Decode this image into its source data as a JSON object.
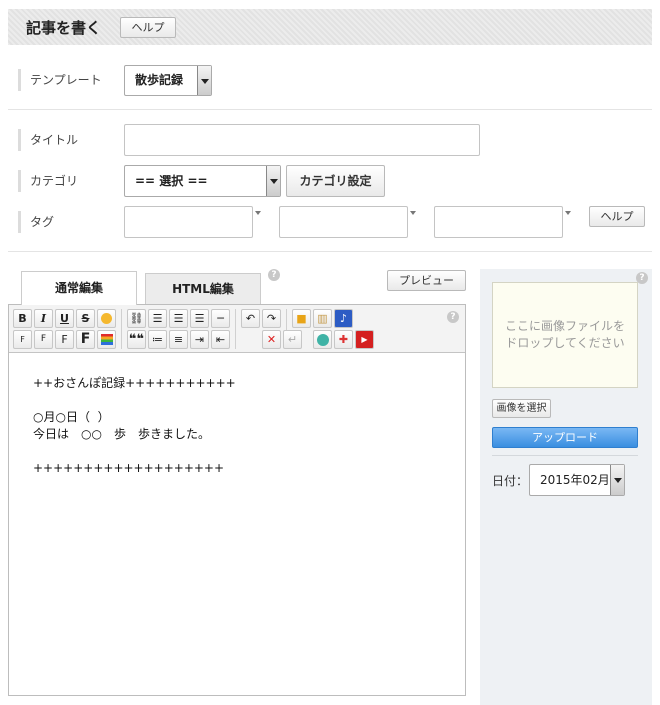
{
  "header": {
    "title": "記事を書く",
    "help": "ヘルプ"
  },
  "template": {
    "label": "テンプレート",
    "selected": "散歩記録"
  },
  "title_row": {
    "label": "タイトル",
    "value": ""
  },
  "category": {
    "label": "カテゴリ",
    "selected": "== 選択 ==",
    "settings_button": "カテゴリ設定"
  },
  "tag": {
    "label": "タグ",
    "help": "ヘルプ",
    "values": [
      "",
      "",
      ""
    ]
  },
  "editor": {
    "tabs": [
      {
        "label": "通常編集",
        "active": true
      },
      {
        "label": "HTML編集",
        "active": false
      }
    ],
    "preview": "プレビュー",
    "help_icon": "?",
    "toolbar": {
      "bold": "B",
      "italic": "I",
      "underline": "U",
      "strike": "S",
      "small_f": "F",
      "quote": "❝❝"
    },
    "body": [
      "++おさんぽ記録+++++++++++",
      "",
      "○月○日（  ）",
      "今日は　○○　歩　歩きました。",
      "",
      "+++++++++++++++++++"
    ]
  },
  "sidebar": {
    "help_icon": "?",
    "drop_text_1": "ここに画像ファイルを",
    "drop_text_2": "ドロップしてください",
    "select_image": "画像を選択",
    "upload": "アップロード",
    "date_label": "日付：",
    "date_selected": "2015年02月"
  },
  "colors": {
    "upload_blue": "#3a8ee0",
    "drop_bg": "#fdfdf1",
    "sidebar_bg": "#eef1f4"
  }
}
